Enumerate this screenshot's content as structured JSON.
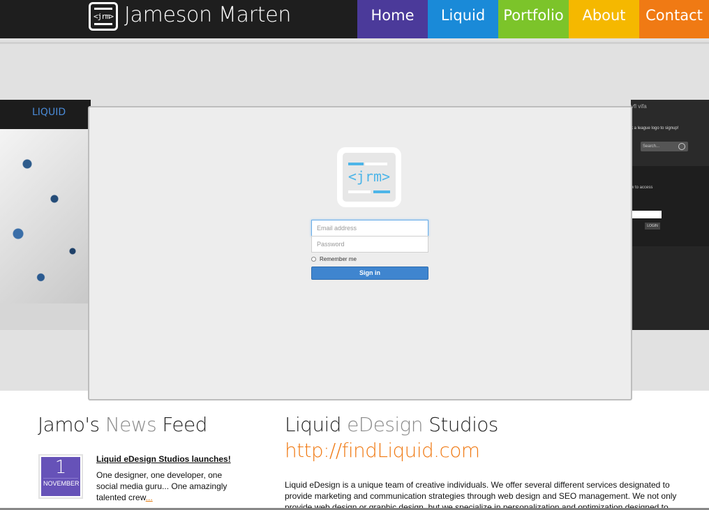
{
  "header": {
    "logo_text": "<jrm>",
    "site_title": "Jameson Marten",
    "nav": [
      {
        "label": "Home",
        "color": "#4b3a9a"
      },
      {
        "label": "Liquid",
        "color": "#1a8ad8"
      },
      {
        "label": "Portfolio",
        "color": "#7cc42a"
      },
      {
        "label": "About",
        "color": "#f5b800"
      },
      {
        "label": "Contact",
        "color": "#f07a14"
      }
    ]
  },
  "slider": {
    "left_slide": {
      "brand": "LIQUID"
    },
    "right_slide": {
      "league_logos": [
        "vfl",
        "vifa"
      ],
      "signup_text": "k a league logo to signup!",
      "search_placeholder": "Search...",
      "access_text": "w to access",
      "login_label": "LOGIN"
    },
    "login_form": {
      "logo_mark": "<jrm>",
      "email_placeholder": "Email address",
      "password_placeholder": "Password",
      "remember_label": "Remember me",
      "signin_label": "Sign in"
    }
  },
  "news_feed": {
    "title_prefix": "Jamo's",
    "title_highlight": "News",
    "title_suffix": "Feed",
    "posts": [
      {
        "day": "1",
        "month": "NOVEMBER",
        "title": "Liquid eDesign Studios launches!",
        "excerpt": "One designer, one developer, one social media guru... One amazingly talented crew",
        "more": "..."
      }
    ]
  },
  "studio": {
    "title_prefix": "Liquid",
    "title_highlight": "eDesign",
    "title_suffix": "Studios",
    "link": "http://findLiquid.com",
    "description": "Liquid eDesign is a unique team of creative individuals. We offer several different services designated to provide marketing and communication strategies through web design and SEO management. We not only provide web design or graphic design, but we specialize in personalization and optimization designed to"
  },
  "colors": {
    "accent_orange": "#f07a14",
    "accent_purple": "#6652b8",
    "signin_blue": "#3f85cf"
  }
}
